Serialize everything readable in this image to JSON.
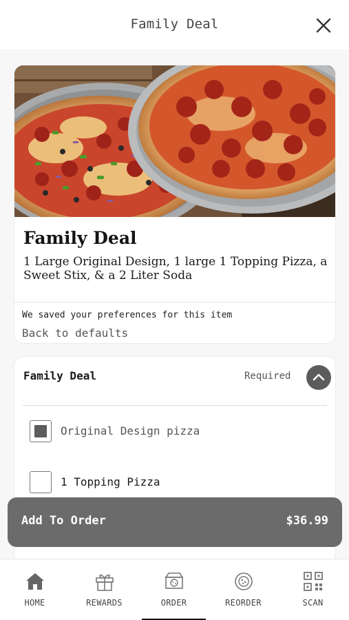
{
  "header": {
    "title": "Family Deal",
    "close_icon": "close-icon"
  },
  "item": {
    "image_alt_icon": "pizza-photo",
    "name": "Family Deal",
    "description": "1 Large Original Design, 1 large 1 Topping Pizza, a Sweet Stix, & a 2 Liter Soda",
    "preferences_note": "We saved your preferences for this item",
    "back_to_defaults": "Back to defaults"
  },
  "options_section": {
    "title": "Family Deal",
    "required_label": "Required",
    "toggle_icon": "chevron-up-icon",
    "options": [
      {
        "label": "Original Design pizza",
        "checked": true
      },
      {
        "label": "1 Topping Pizza",
        "checked": false
      }
    ]
  },
  "add_to_order": {
    "label": "Add To Order",
    "price": "$36.99"
  },
  "bottom_nav": {
    "items": [
      {
        "label": "HOME",
        "icon": "home-icon",
        "active": false
      },
      {
        "label": "REWARDS",
        "icon": "gift-icon",
        "active": false
      },
      {
        "label": "ORDER",
        "icon": "pizza-box-icon",
        "active": true
      },
      {
        "label": "REORDER",
        "icon": "reorder-icon",
        "active": false
      },
      {
        "label": "SCAN",
        "icon": "qr-code-icon",
        "active": false
      }
    ]
  },
  "colors": {
    "button": "#6b6b6b",
    "toggle": "#5c5c5c",
    "background": "#f7f7f7",
    "nav_active": "#111111"
  }
}
